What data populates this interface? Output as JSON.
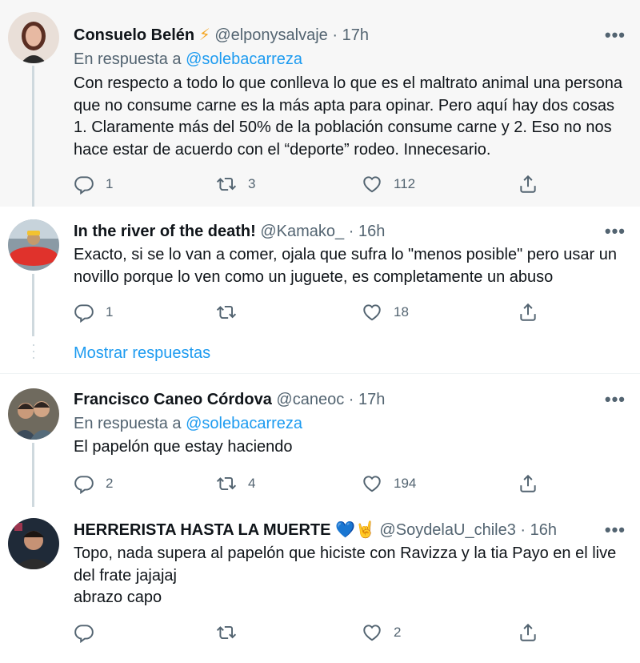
{
  "tweets": [
    {
      "name": "Consuelo Belén",
      "badge": "⚡",
      "handle": "@elponysalvaje",
      "time": "17h",
      "reply_prefix": "En respuesta a",
      "reply_handle": "@solebacarreza",
      "text": "Con respecto a todo lo que conlleva lo que es el maltrato animal una persona que no consume carne es la más apta para opinar. Pero aquí hay dos cosas 1. Claramente más del 50% de la población consume carne y 2. Eso no nos hace estar de acuerdo con el “deporte” rodeo. Innecesario.",
      "replies": "1",
      "retweets": "3",
      "likes": "112"
    },
    {
      "name": "In the river of the death!",
      "handle": "@Kamako_",
      "time": "16h",
      "text": "Exacto, si se lo van a comer, ojala que sufra lo \"menos posible\" pero usar un novillo porque lo ven como un juguete, es completamente un abuso",
      "replies": "1",
      "retweets": "",
      "likes": "18"
    },
    {
      "name": "Francisco Caneo Córdova",
      "handle": "@caneoc",
      "time": "17h",
      "reply_prefix": "En respuesta a",
      "reply_handle": "@solebacarreza",
      "text": "El papelón que estay haciendo",
      "replies": "2",
      "retweets": "4",
      "likes": "194"
    },
    {
      "name": "HERRERISTA HASTA LA MUERTE",
      "badge": "💙🤘",
      "handle": "@SoydelaU_chile3",
      "time": "16h",
      "text_lines": [
        "Topo, nada supera al papelón que hiciste con Ravizza y la tia Payo en el live del frate jajajaj",
        "abrazo capo"
      ],
      "replies": "",
      "retweets": "",
      "likes": "2"
    }
  ],
  "show_replies": "Mostrar respuestas",
  "separator_dot": "·",
  "more_glyph": "•••",
  "icons": [
    "reply-icon",
    "retweet-icon",
    "like-icon",
    "share-icon",
    "more-icon"
  ],
  "colors": {
    "accent": "#1d9bf0",
    "muted": "#536471",
    "text": "#0f1419",
    "highlight_bg": "#f7f7f7",
    "thread_line": "#cfd9de"
  }
}
